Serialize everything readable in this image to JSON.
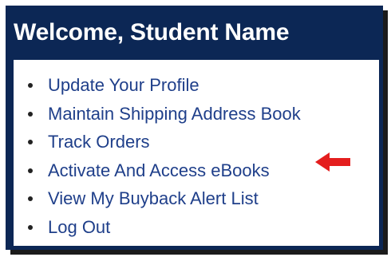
{
  "panel": {
    "title": "Welcome, Student Name"
  },
  "menu": {
    "items": [
      {
        "label": "Update Your Profile"
      },
      {
        "label": "Maintain Shipping Address Book"
      },
      {
        "label": "Track Orders"
      },
      {
        "label": "Activate And Access eBooks"
      },
      {
        "label": "View My Buyback Alert List"
      },
      {
        "label": "Log Out"
      }
    ]
  },
  "annotation": {
    "icon": "left-arrow-icon",
    "color": "#e41e1e",
    "points_to": "Activate And Access eBooks"
  },
  "colors": {
    "header_bg": "#0c2755",
    "link": "#1f3f8a"
  }
}
